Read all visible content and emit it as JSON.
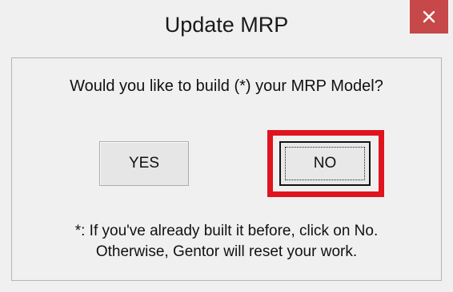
{
  "dialog": {
    "title": "Update MRP",
    "close_glyph": "✕",
    "close_icon": "close-icon",
    "message": "Would you like to build (*) your MRP Model?",
    "yes_label": "YES",
    "no_label": "NO",
    "note_line1": "*: If you've already built it before, click on No.",
    "note_line2": "Otherwise, Gentor will reset your work."
  },
  "colors": {
    "close_button_bg": "#c74848",
    "highlight_border": "#e0141e",
    "dialog_bg": "#f0f0f0"
  }
}
